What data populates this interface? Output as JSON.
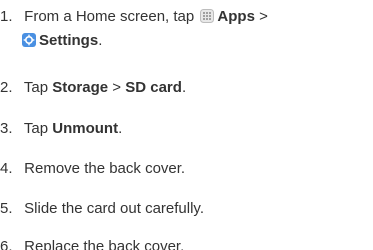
{
  "steps": [
    {
      "number": "1.",
      "line1": {
        "prefix": "From a Home screen, tap",
        "apps": "Apps",
        "arrow": ">"
      },
      "line2": {
        "settings": "Settings",
        "end": "."
      }
    },
    {
      "number": "2.",
      "pre": "Tap ",
      "b1": "Storage",
      "mid": " > ",
      "b2": "SD card",
      "end": "."
    },
    {
      "number": "3.",
      "pre": "Tap ",
      "b1": "Unmount",
      "end": "."
    },
    {
      "number": "4.",
      "text": "Remove the back cover."
    },
    {
      "number": "5.",
      "text": "Slide the card out carefully."
    },
    {
      "number": "6.",
      "text": "Replace the back cover."
    }
  ],
  "icons": {
    "apps": "apps-grid-icon",
    "settings": "settings-gear-icon"
  },
  "colors": {
    "text": "#333333",
    "settings_icon_bg": "#4a90e2"
  }
}
